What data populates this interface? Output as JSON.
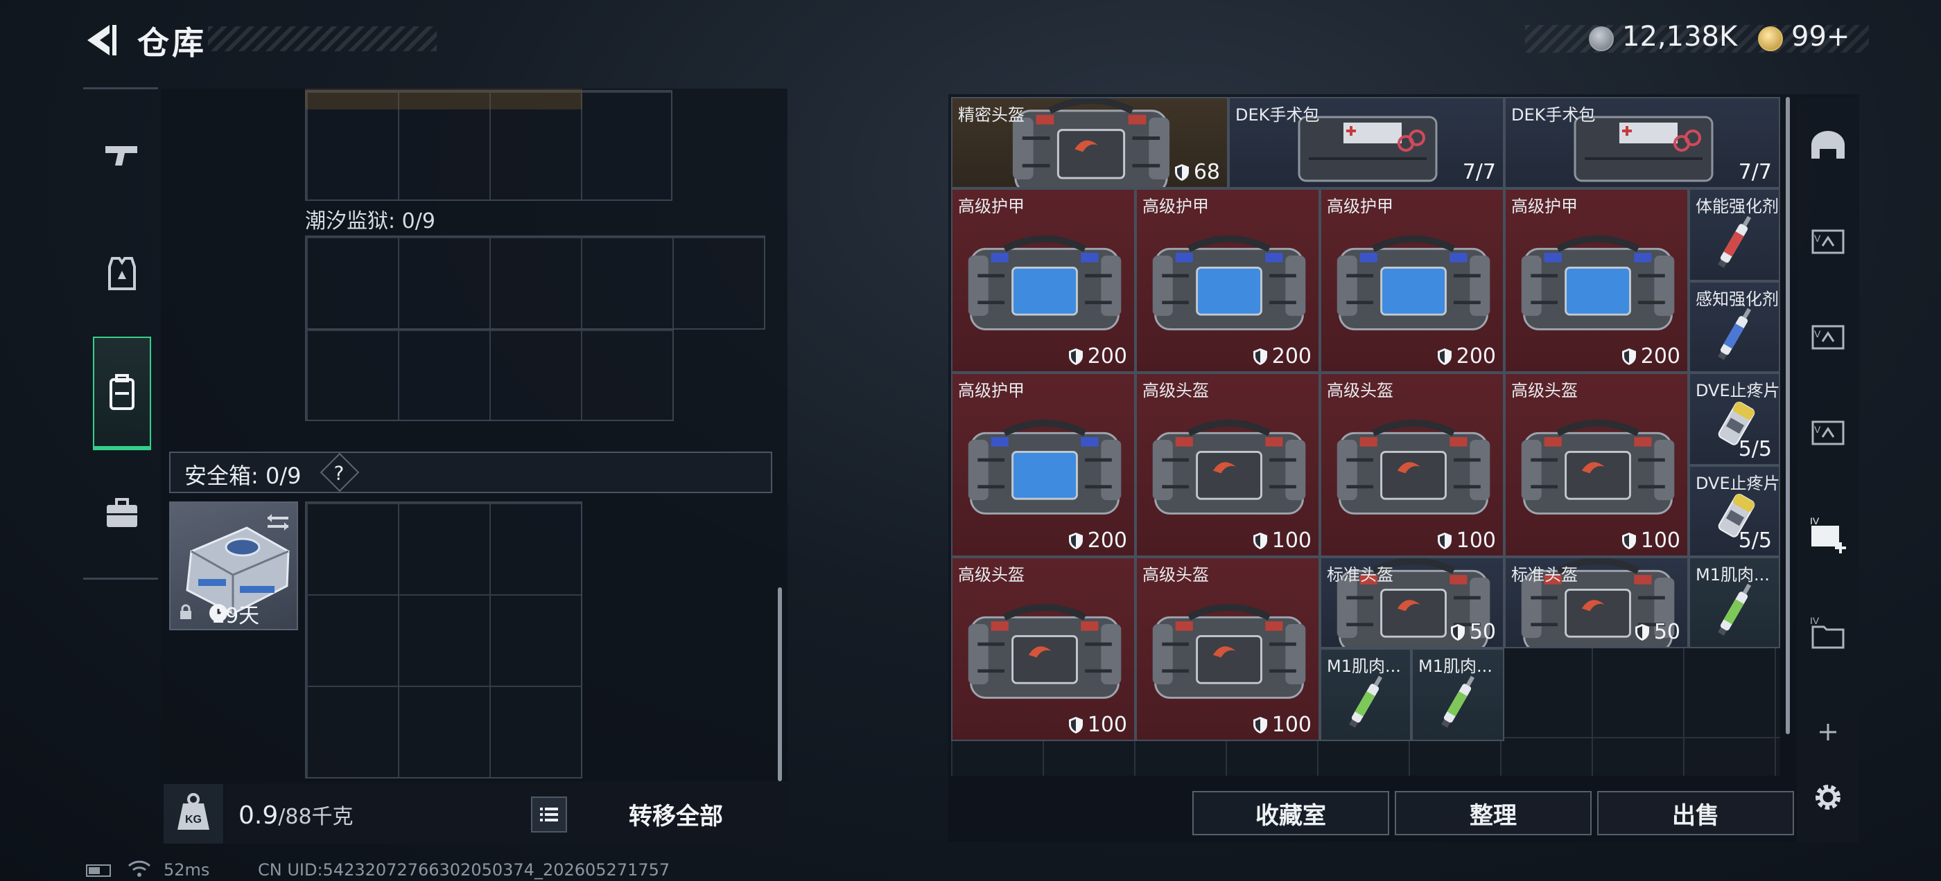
{
  "header": {
    "title": "仓库",
    "money": "12,138K",
    "bonds": "99+"
  },
  "left_nav": [
    {
      "name": "weapons",
      "icon": "pistol-icon"
    },
    {
      "name": "armor",
      "icon": "vest-icon"
    },
    {
      "name": "backpack",
      "icon": "backpack-icon",
      "active": true
    },
    {
      "name": "case",
      "icon": "briefcase-icon"
    }
  ],
  "loadout": {
    "prison_label": "潮汐监狱: 0/9",
    "safe_label": "安全箱: 0/9",
    "safe_help": "?",
    "safe_timer": "29天",
    "weight_value": "0.9",
    "weight_unit": "/88千克",
    "transfer_all": "转移全部"
  },
  "stash_items": [
    {
      "id": "i1",
      "name": "精密头盔",
      "value": "68",
      "shield": true,
      "tint": "gold",
      "art": "bag-red"
    },
    {
      "id": "i2",
      "name": "DEK手术包",
      "value": "7/7",
      "shield": false,
      "tint": "blue",
      "art": "medkit"
    },
    {
      "id": "i3",
      "name": "DEK手术包",
      "value": "7/7",
      "shield": false,
      "tint": "blue",
      "art": "medkit"
    },
    {
      "id": "i4",
      "name": "高级护甲",
      "value": "200",
      "shield": true,
      "tint": "red",
      "art": "bag-blue"
    },
    {
      "id": "i5",
      "name": "高级护甲",
      "value": "200",
      "shield": true,
      "tint": "red",
      "art": "bag-blue"
    },
    {
      "id": "i6",
      "name": "高级护甲",
      "value": "200",
      "shield": true,
      "tint": "red",
      "art": "bag-blue"
    },
    {
      "id": "i7",
      "name": "高级护甲",
      "value": "200",
      "shield": true,
      "tint": "red",
      "art": "bag-blue"
    },
    {
      "id": "i8",
      "name": "体能强化剂",
      "value": "",
      "shield": false,
      "tint": "blue",
      "art": "syringe-red"
    },
    {
      "id": "i9",
      "name": "感知强化剂",
      "value": "",
      "shield": false,
      "tint": "blue",
      "art": "syringe-blue"
    },
    {
      "id": "i10",
      "name": "高级护甲",
      "value": "200",
      "shield": true,
      "tint": "red",
      "art": "bag-blue"
    },
    {
      "id": "i11",
      "name": "高级头盔",
      "value": "100",
      "shield": true,
      "tint": "red",
      "art": "bag-red"
    },
    {
      "id": "i12",
      "name": "高级头盔",
      "value": "100",
      "shield": true,
      "tint": "red",
      "art": "bag-red"
    },
    {
      "id": "i13",
      "name": "高级头盔",
      "value": "100",
      "shield": true,
      "tint": "red",
      "art": "bag-red"
    },
    {
      "id": "i14",
      "name": "DVE止疼片",
      "value": "5/5",
      "shield": false,
      "tint": "blue",
      "art": "pills"
    },
    {
      "id": "i15",
      "name": "DVE止疼片",
      "value": "5/5",
      "shield": false,
      "tint": "blue",
      "art": "pills"
    },
    {
      "id": "i16",
      "name": "高级头盔",
      "value": "100",
      "shield": true,
      "tint": "red",
      "art": "bag-red"
    },
    {
      "id": "i17",
      "name": "高级头盔",
      "value": "100",
      "shield": true,
      "tint": "red",
      "art": "bag-red"
    },
    {
      "id": "i18",
      "name": "标准头盔",
      "value": "50",
      "shield": true,
      "tint": "blue",
      "art": "bag-red"
    },
    {
      "id": "i19",
      "name": "标准头盔",
      "value": "50",
      "shield": true,
      "tint": "blue",
      "art": "bag-red"
    },
    {
      "id": "i20",
      "name": "M1肌肉...",
      "value": "",
      "shield": false,
      "tint": "teal",
      "art": "syringe-green"
    },
    {
      "id": "i21",
      "name": "M1肌肉...",
      "value": "",
      "shield": false,
      "tint": "teal",
      "art": "syringe-green"
    },
    {
      "id": "i22",
      "name": "M1肌肉...",
      "value": "",
      "shield": false,
      "tint": "teal",
      "art": "syringe-green"
    }
  ],
  "actions": {
    "collection": "收藏室",
    "sort": "整理",
    "sell": "出售"
  },
  "right_rail": [
    {
      "icon": "dome-icon"
    },
    {
      "icon": "case-slot-icon"
    },
    {
      "icon": "case-slot-icon"
    },
    {
      "icon": "case-slot-icon"
    },
    {
      "icon": "add-medkit-case-icon",
      "label": "IV"
    },
    {
      "icon": "folder-case-icon",
      "label": "IV"
    },
    {
      "icon": "plus-icon"
    },
    {
      "icon": "gear-icon"
    }
  ],
  "footer": {
    "ping": "52ms",
    "uid": "CN UID:54232072766302050374_202605271757"
  },
  "colors": {
    "accent_green": "#34d08a",
    "tile_red": "#5b2329",
    "tile_blue": "#2b3446"
  }
}
